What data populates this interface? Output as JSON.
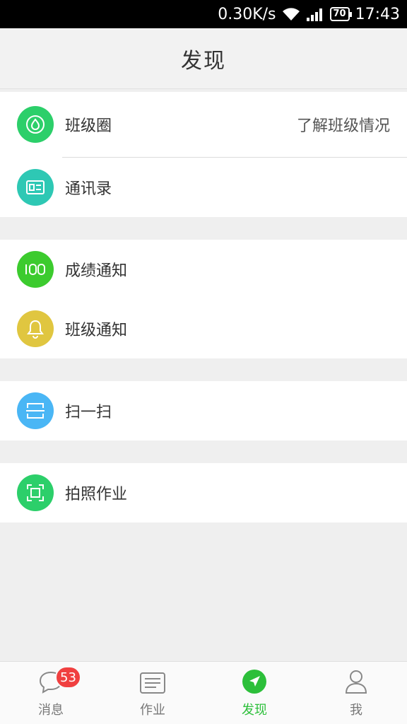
{
  "status_bar": {
    "speed": "0.30K/s",
    "battery": "70",
    "time": "17:43"
  },
  "header": {
    "title": "发现"
  },
  "groups": [
    {
      "items": [
        {
          "label": "班级圈",
          "right": "了解班级情况",
          "icon": "drop-icon",
          "color": "#2ccf6a"
        },
        {
          "label": "通讯录",
          "icon": "contact-card-icon",
          "color": "#2ec8b4"
        }
      ]
    },
    {
      "items": [
        {
          "label": "成绩通知",
          "icon": "score-100-icon",
          "color": "#3ccb2e"
        },
        {
          "label": "班级通知",
          "icon": "bell-icon",
          "color": "#e0c640"
        }
      ]
    },
    {
      "items": [
        {
          "label": "扫一扫",
          "icon": "scan-icon",
          "color": "#4ab6f5"
        }
      ]
    },
    {
      "items": [
        {
          "label": "拍照作业",
          "icon": "camera-frame-icon",
          "color": "#2ccf6a"
        }
      ]
    }
  ],
  "tabs": [
    {
      "label": "消息",
      "badge": "53",
      "icon": "chat-bubble-icon"
    },
    {
      "label": "作业",
      "icon": "document-icon"
    },
    {
      "label": "发现",
      "icon": "compass-icon",
      "active": true
    },
    {
      "label": "我",
      "icon": "person-icon"
    }
  ]
}
